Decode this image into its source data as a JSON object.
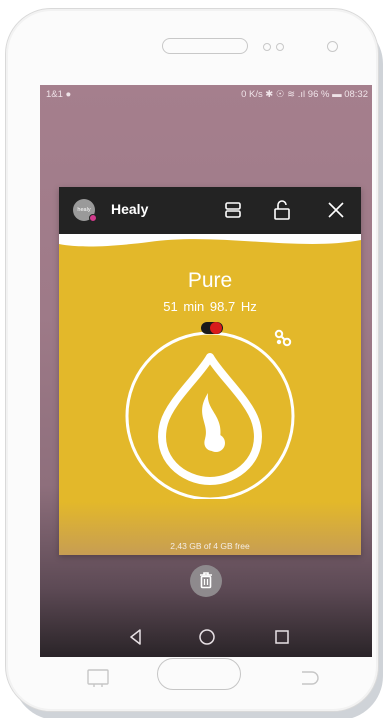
{
  "status_bar": {
    "carrier": "1&1",
    "right": "0 K/s ✱ ☉ ≋ .ıl 96 % ▬ 08:32"
  },
  "app": {
    "logo_text": "healy",
    "name": "Healy"
  },
  "program": {
    "name": "Pure",
    "duration": "51 min",
    "frequency": "98.7 Hz",
    "toggle_on": true
  },
  "storage": {
    "text": "2,43 GB of 4 GB free"
  },
  "icons": {
    "window_mode": "split-window-icon",
    "lock": "unlock-icon",
    "close": "close-icon",
    "drop": "water-drop-icon",
    "butterfly": "butterfly-icon",
    "trash": "trash-icon",
    "nav_back": "back-triangle-icon",
    "nav_home": "home-circle-icon",
    "nav_recent": "recent-square-icon"
  },
  "colors": {
    "card_bg": "#e3b82a",
    "titlebar_bg": "#232323",
    "toggle_knob": "#d81b1b",
    "screen_bg": "#a57f8d"
  }
}
